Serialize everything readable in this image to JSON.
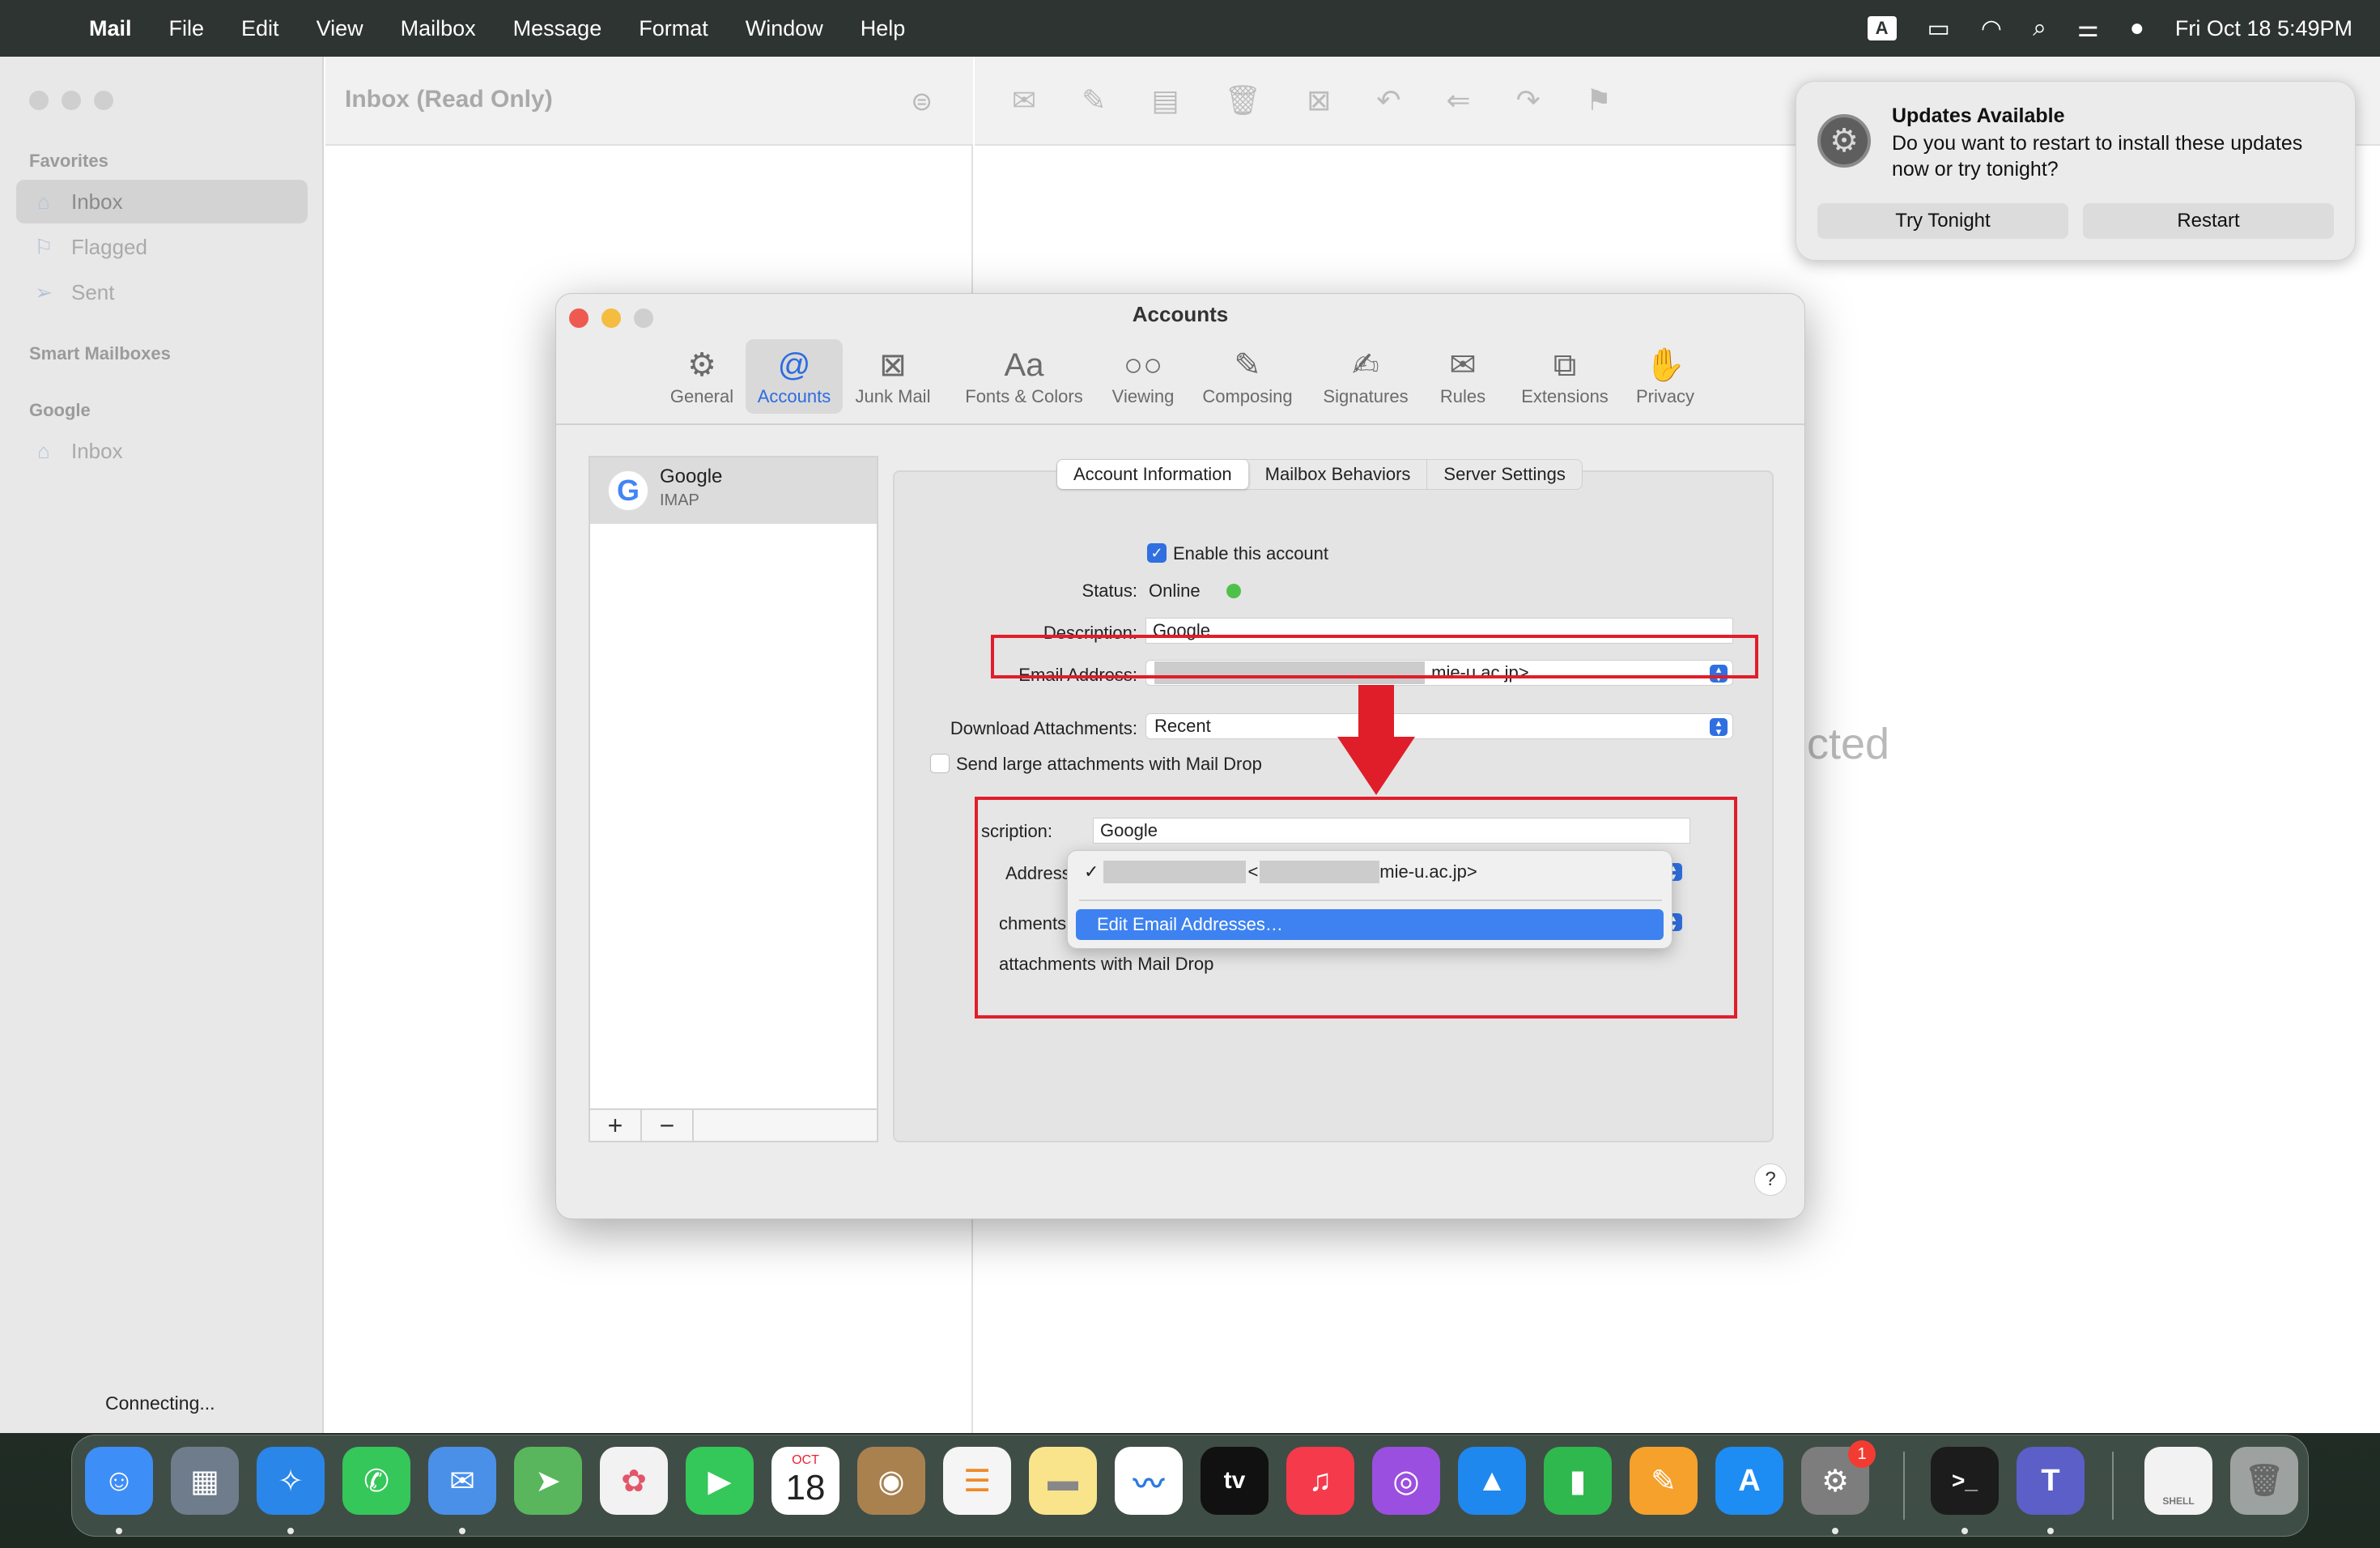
{
  "menubar": {
    "app": "Mail",
    "items": [
      "File",
      "Edit",
      "View",
      "Mailbox",
      "Message",
      "Format",
      "Window",
      "Help"
    ],
    "input_source": "A",
    "clock": "Fri Oct 18  5:49PM"
  },
  "sidebar": {
    "favorites_heading": "Favorites",
    "favorites": [
      {
        "label": "Inbox",
        "icon": "tray-icon"
      },
      {
        "label": "Flagged",
        "icon": "flag-icon"
      },
      {
        "label": "Sent",
        "icon": "paperplane-icon"
      }
    ],
    "smart_heading": "Smart Mailboxes",
    "google_heading": "Google",
    "google_items": [
      {
        "label": "Inbox",
        "icon": "tray-icon"
      }
    ],
    "status": "Connecting..."
  },
  "message_list": {
    "title": "Inbox (Read Only)"
  },
  "message_view": {
    "placeholder": "cted"
  },
  "notification": {
    "title": "Updates Available",
    "body": "Do you want to restart to install these updates now or try tonight?",
    "button_later": "Try Tonight",
    "button_restart": "Restart"
  },
  "dialog": {
    "title": "Accounts",
    "tabs": [
      "General",
      "Accounts",
      "Junk Mail",
      "Fonts & Colors",
      "Viewing",
      "Composing",
      "Signatures",
      "Rules",
      "Extensions",
      "Privacy"
    ],
    "selected_tab": "Accounts",
    "account": {
      "name": "Google",
      "type": "IMAP"
    },
    "list_add": "+",
    "list_remove": "−",
    "segments": [
      "Account Information",
      "Mailbox Behaviors",
      "Server Settings"
    ],
    "enable_label": "Enable this account",
    "status_label": "Status:",
    "status_value": "Online",
    "description_label": "Description:",
    "description_value": "Google",
    "email_label": "Email Address:",
    "email_value": ".mie-u.ac.jp>",
    "download_label": "Download Attachments:",
    "download_value": "Recent",
    "maildrop_label": "Send large attachments with Mail Drop",
    "help": "?"
  },
  "inset": {
    "description_label": "scription:",
    "description_value": "Google",
    "address_label": "Address",
    "attachments_label": "chments",
    "maildrop_text": "attachments with Mail Drop",
    "menu_item_email": "mie-u.ac.jp>",
    "menu_item_lt1": "<",
    "menu_item_lt2": "<",
    "menu_check": "✓",
    "menu_edit": "Edit Email Addresses…"
  },
  "dock": {
    "calendar_month": "OCT",
    "calendar_day": "18",
    "settings_badge": "1",
    "tv_label": "tv",
    "shell_label": "SHELL"
  },
  "colors": {
    "accent": "#2f6fe0",
    "highlight": "#e01e2a",
    "online": "#4fc14a"
  }
}
